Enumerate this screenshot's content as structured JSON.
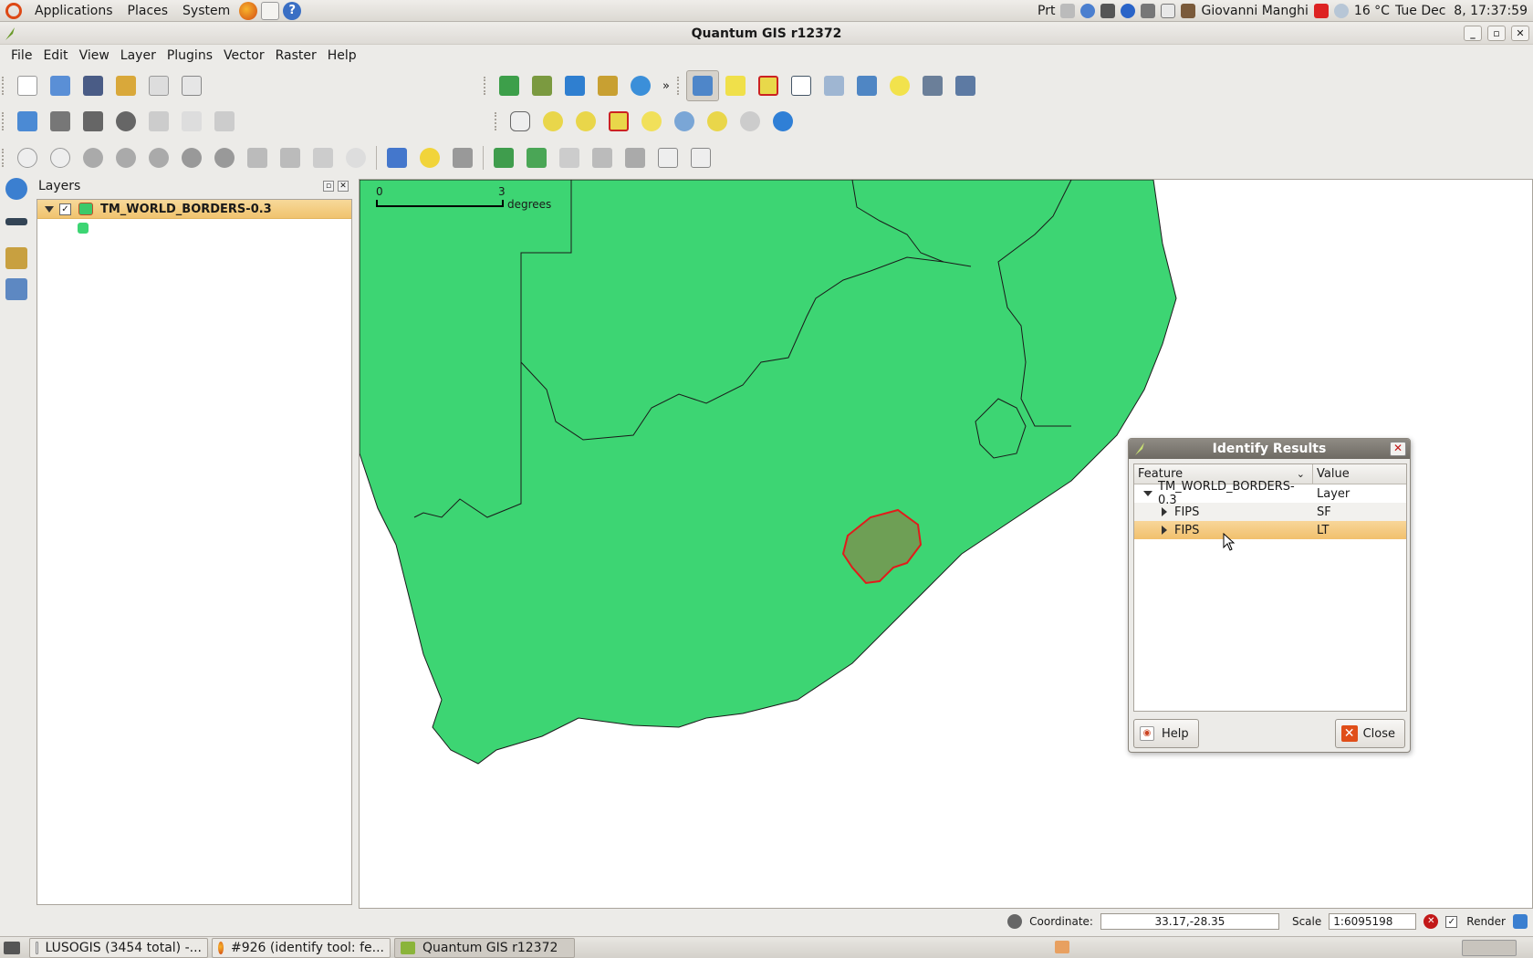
{
  "panel": {
    "menus": [
      "Applications",
      "Places",
      "System"
    ],
    "print_label": "Prt",
    "user": "Giovanni Manghi",
    "weather": "16 °C",
    "clock": "Tue Dec  8, 17:37:59"
  },
  "window": {
    "title": "Quantum GIS r12372"
  },
  "menubar": [
    "File",
    "Edit",
    "View",
    "Layer",
    "Plugins",
    "Vector",
    "Raster",
    "Help"
  ],
  "layers": {
    "title": "Layers",
    "items": [
      {
        "name": "TM_WORLD_BORDERS-0.3",
        "visible": true
      }
    ]
  },
  "map": {
    "scalebar": {
      "start": "0",
      "end": "3",
      "unit": "degrees"
    },
    "fill_color": "#3dd573",
    "highlight_color": "#e21b1b"
  },
  "identify": {
    "title": "Identify Results",
    "columns": [
      "Feature",
      "Value"
    ],
    "rows": [
      {
        "feature": "TM_WORLD_BORDERS-0.3",
        "value": "Layer"
      },
      {
        "feature": "FIPS",
        "value": "SF"
      },
      {
        "feature": "FIPS",
        "value": "LT"
      }
    ],
    "help_label": "Help",
    "close_label": "Close"
  },
  "status": {
    "coordinate_label": "Coordinate:",
    "coordinate_value": "33.17,-28.35",
    "scale_label": "Scale",
    "scale_value": "1:6095198",
    "render_label": "Render"
  },
  "taskbar": [
    {
      "label": "LUSOGIS (3454 total) -..."
    },
    {
      "label": "#926 (identify tool: fe..."
    },
    {
      "label": "Quantum GIS r12372"
    }
  ]
}
